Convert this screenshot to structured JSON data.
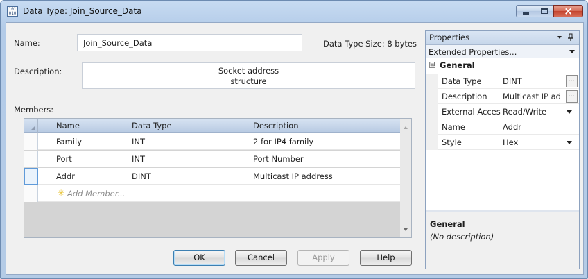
{
  "window": {
    "title": "Data Type: Join_Source_Data",
    "app_icon_text": "101 010",
    "controls": {
      "minimize": "minimize",
      "maximize": "maximize",
      "close": "×"
    }
  },
  "form": {
    "name_label": "Name:",
    "name_value": "Join_Source_Data",
    "size_label": "Data Type Size: 8 bytes",
    "description_label": "Description:",
    "description_line1": "Socket address",
    "description_line2": "structure",
    "members_label": "Members:"
  },
  "members": {
    "columns": [
      "Name",
      "Data Type",
      "Description"
    ],
    "rows": [
      {
        "name": "Family",
        "type": "INT",
        "description": "2 for IP4 family"
      },
      {
        "name": "Port",
        "type": "INT",
        "description": "Port Number"
      },
      {
        "name": "Addr",
        "type": "DINT",
        "description": "Multicast IP address"
      }
    ],
    "add_member": "Add Member..."
  },
  "buttons": {
    "ok": "OK",
    "cancel": "Cancel",
    "apply": "Apply",
    "help": "Help"
  },
  "properties": {
    "title": "Properties",
    "pin_icon": "pin-icon",
    "category": "Extended Properties...",
    "section": "General",
    "expander": "⊟",
    "rows": [
      {
        "name": "Data Type",
        "value": "DINT",
        "control": "ellipsis"
      },
      {
        "name": "Description",
        "value": "Multicast IP ad",
        "control": "ellipsis"
      },
      {
        "name": "External Acces",
        "value": "Read/Write",
        "control": "dropdown"
      },
      {
        "name": "Name",
        "value": "Addr",
        "control": "none"
      },
      {
        "name": "Style",
        "value": "Hex",
        "control": "dropdown"
      }
    ],
    "help_title": "General",
    "help_text": "(No description)"
  },
  "colors": {
    "accent": "#3c7fb1",
    "title_bar": "#c7dbf2",
    "add_member_star": "#e8c53a"
  }
}
